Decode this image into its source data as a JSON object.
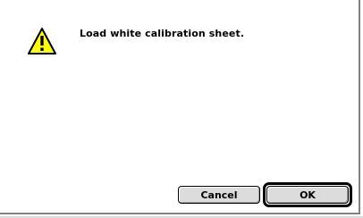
{
  "dialog": {
    "message": "Load white calibration sheet.",
    "icon": "caution-icon",
    "buttons": {
      "cancel_label": "Cancel",
      "ok_label": "OK"
    },
    "default_button": "OK"
  },
  "colors": {
    "background": "#ffffff",
    "button_face": "#dcdcdc",
    "caution_yellow": "#ffff00",
    "border": "#000000",
    "shadow": "#808080"
  }
}
